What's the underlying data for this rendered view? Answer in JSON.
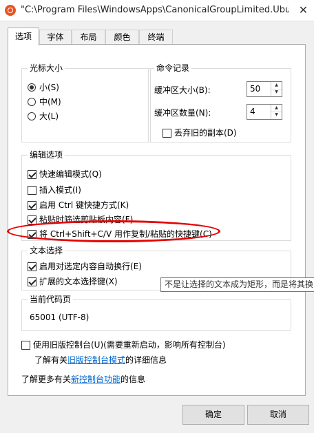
{
  "window": {
    "title": "\"C:\\Program Files\\WindowsApps\\CanonicalGroupLimited.Ubuntu...",
    "close_symbol": "✕"
  },
  "tabs": [
    "选项",
    "字体",
    "布局",
    "颜色",
    "终端"
  ],
  "cursor_size": {
    "title": "光标大小",
    "small": "小(S)",
    "medium": "中(M)",
    "large": "大(L)",
    "selected": "小(S)"
  },
  "command_history": {
    "title": "命令记录",
    "buffer_size_label": "缓冲区大小(B):",
    "buffer_size_value": "50",
    "buffer_count_label": "缓冲区数量(N):",
    "buffer_count_value": "4",
    "discard_old_label": "丢弃旧的副本(D)",
    "discard_old_checked": false
  },
  "edit_options": {
    "title": "编辑选项",
    "items": [
      {
        "label": "快速编辑模式(Q)",
        "checked": true
      },
      {
        "label": "插入模式(I)",
        "checked": false
      },
      {
        "label": "启用 Ctrl 键快捷方式(K)",
        "checked": true
      },
      {
        "label": "粘贴时筛选剪贴板内容(F)",
        "checked": true
      },
      {
        "label": "将 Ctrl+Shift+C/V 用作复制/粘贴的快捷键(C)",
        "checked": true
      }
    ]
  },
  "text_selection": {
    "title": "文本选择",
    "items": [
      {
        "label": "启用对选定内容自动换行(E)",
        "checked": true
      },
      {
        "label": "扩展的文本选择键(X)",
        "checked": true
      }
    ]
  },
  "tooltip": "不是让选择的文本成为矩形，而是将其换",
  "code_page": {
    "title": "当前代码页",
    "value": "65001 (UTF-8)"
  },
  "legacy": {
    "checkbox_label": "使用旧版控制台(U)(需要重新启动，影响所有控制台)",
    "checked": false,
    "info_prefix": "了解有关",
    "info_link": "旧版控制台模式",
    "info_suffix": "的详细信息"
  },
  "more_info": {
    "prefix": "了解更多有关",
    "link": "新控制台功能",
    "suffix": "的信息"
  },
  "buttons": {
    "ok": "确定",
    "cancel": "取消"
  },
  "colors": {
    "annotation": "#e60000",
    "link": "#0066cc",
    "app_icon": "#e95420"
  }
}
